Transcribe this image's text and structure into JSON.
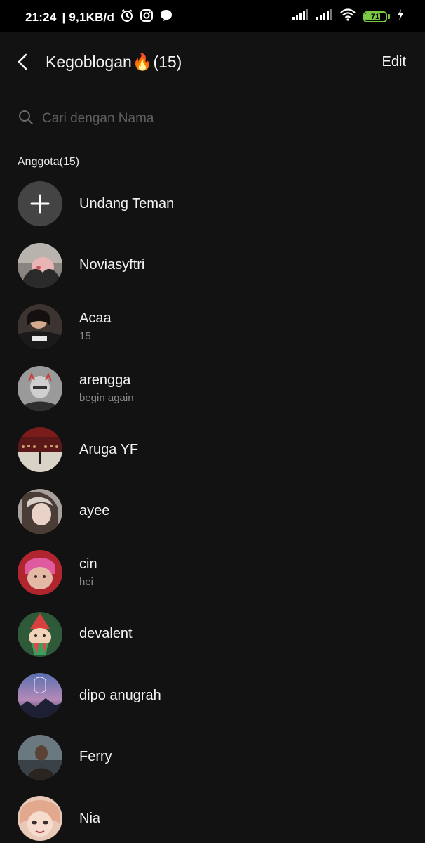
{
  "status_bar": {
    "time": "21:24",
    "speed": "| 9,1KB/d",
    "icons": [
      "alarm-icon",
      "instagram-icon",
      "chat-bubble-icon"
    ],
    "battery_level": "71",
    "right_icons": [
      "signal-icon",
      "signal-icon",
      "wifi-icon",
      "battery-icon",
      "charging-icon"
    ]
  },
  "header": {
    "title": "Kegoblogan",
    "emoji": "🔥",
    "count": "(15)",
    "edit_label": "Edit"
  },
  "search": {
    "placeholder": "Cari dengan Nama"
  },
  "section": {
    "label": "Anggota(15)"
  },
  "invite": {
    "label": "Undang Teman"
  },
  "members": [
    {
      "name": "Noviasyftri",
      "subtitle": ""
    },
    {
      "name": "Acaa",
      "subtitle": "15"
    },
    {
      "name": "arengga",
      "subtitle": "begin again"
    },
    {
      "name": "Aruga YF",
      "subtitle": ""
    },
    {
      "name": "ayee",
      "subtitle": ""
    },
    {
      "name": "cin",
      "subtitle": "hei"
    },
    {
      "name": "devalent",
      "subtitle": ""
    },
    {
      "name": "dipo anugrah",
      "subtitle": ""
    },
    {
      "name": "Ferry",
      "subtitle": ""
    },
    {
      "name": "Nia",
      "subtitle": ""
    }
  ],
  "colors": {
    "background": "#121212",
    "status_bar": "#000000",
    "battery": "#7ac943",
    "secondary_text": "#8a8a8a"
  }
}
